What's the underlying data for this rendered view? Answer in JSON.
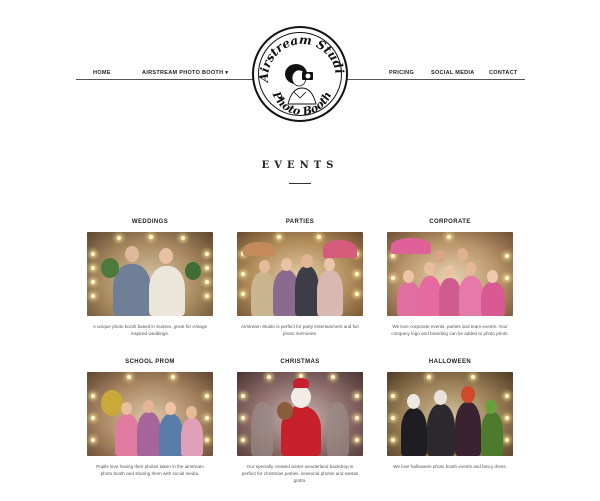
{
  "nav": {
    "home": "HOME",
    "photo_booth": "AIRSTREAM PHOTO BOOTH ▾",
    "pricing": "PRICING",
    "social_media": "SOCIAL MEDIA",
    "contact": "CONTACT"
  },
  "logo": {
    "top_text": "Airstream Studio",
    "bottom_text": "Photo Booth"
  },
  "page_title": "EVENTS",
  "cards": [
    {
      "title": "WEDDINGS",
      "description": "A unique photo booth based in Sussex, great for vintage inspired weddings."
    },
    {
      "title": "PARTIES",
      "description": "Airstream Studio is perfect for party entertainment and fun photo memories."
    },
    {
      "title": "CORPORATE",
      "description": "We love corporate events, parties and team events. Your company logo and branding can be added to photo prints."
    },
    {
      "title": "SCHOOL PROM",
      "description": "Pupils love having their photos taken in the airstream photo booth and sharing them with social media."
    },
    {
      "title": "CHRISTMAS",
      "description": "Our specially created winter wonderland backdrop is perfect for christmas parties, seasonal photos and santas grotto."
    },
    {
      "title": "HALLOWEEN",
      "description": "We love halloween photo booth events and fancy dress."
    }
  ]
}
